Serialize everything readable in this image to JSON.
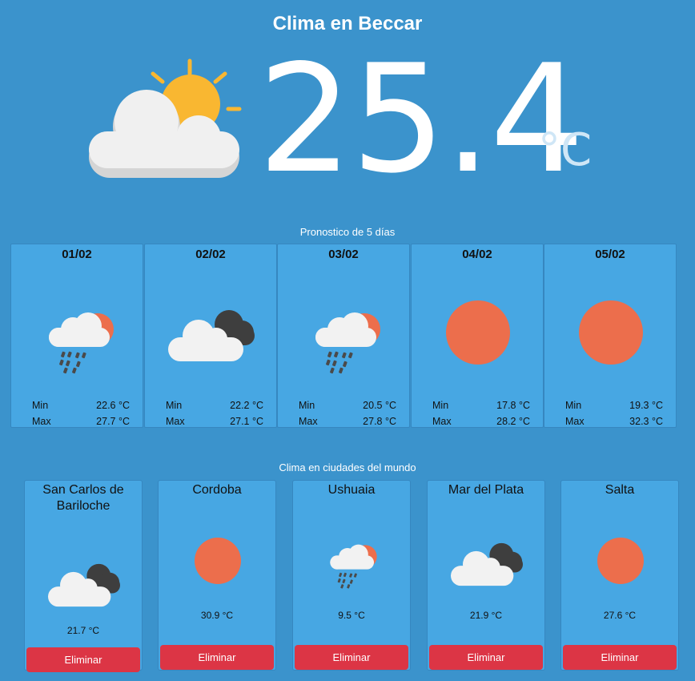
{
  "header": {
    "title": "Clima en Beccar",
    "icon": "partly-sunny-cloud-icon",
    "temperature": "25.4",
    "unit": "°C"
  },
  "forecast": {
    "section_title": "Pronostico de 5 días",
    "min_label": "Min",
    "max_label": "Max",
    "days": [
      {
        "date": "01/02",
        "icon": "sun-cloud-rain-icon",
        "min": "22.6 °C",
        "max": "27.7 °C"
      },
      {
        "date": "02/02",
        "icon": "dark-clouds-icon",
        "min": "22.2 °C",
        "max": "27.1 °C"
      },
      {
        "date": "03/02",
        "icon": "sun-cloud-rain-icon",
        "min": "20.5 °C",
        "max": "27.8 °C"
      },
      {
        "date": "04/02",
        "icon": "sun-icon",
        "min": "17.8 °C",
        "max": "28.2 °C"
      },
      {
        "date": "05/02",
        "icon": "sun-icon",
        "min": "19.3 °C",
        "max": "32.3 °C"
      }
    ]
  },
  "cities": {
    "section_title": "Clima en ciudades del mundo",
    "delete_label": "Eliminar",
    "items": [
      {
        "name": "San Carlos de Bariloche",
        "icon": "dark-clouds-icon",
        "temp": "21.7 °C"
      },
      {
        "name": "Cordoba",
        "icon": "sun-icon",
        "temp": "30.9 °C"
      },
      {
        "name": "Ushuaia",
        "icon": "sun-cloud-rain-icon",
        "temp": "9.5 °C"
      },
      {
        "name": "Mar del Plata",
        "icon": "dark-clouds-icon",
        "temp": "21.9 °C"
      },
      {
        "name": "Salta",
        "icon": "sun-icon",
        "temp": "27.6 °C"
      }
    ]
  },
  "colors": {
    "background": "#3b93cc",
    "card": "#47a7e3",
    "sun": "#ec6e4c",
    "hero_sun": "#f9b731",
    "delete_button": "#dc3545"
  }
}
